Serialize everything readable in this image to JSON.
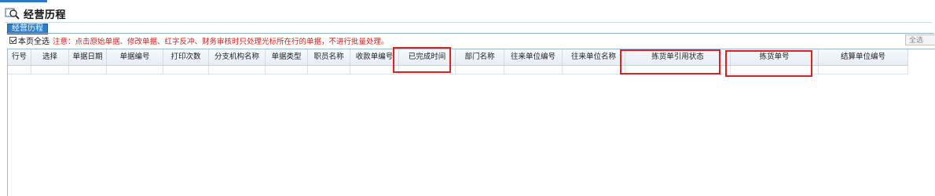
{
  "page": {
    "title": "经营历程",
    "tab_label": "经营历程",
    "select_all_label": "本页全选",
    "notice": "注意：点击原始单据、修改单据、红字反冲、财务审核时只处理光标所在行的单据，不进行批量处理。",
    "corner_button_label": "全选",
    "select_all_checked": true
  },
  "grid": {
    "columns": [
      "行号",
      "选择",
      "单据日期",
      "单据编号",
      "打印次数",
      "分支机构名称",
      "单据类型",
      "职员名称",
      "收款单编号",
      "已完成时间",
      "部门名称",
      "往来单位编号",
      "往来单位名称",
      "拣货单引用状态",
      "拣货单号",
      "结算单位编号"
    ],
    "rows": []
  },
  "colors": {
    "tab_bg": "#2f7ec6",
    "notice": "#d42020",
    "highlight": "#e02020",
    "grid_border": "#99bbd9"
  },
  "icons": {
    "title": "search-history-icon"
  }
}
